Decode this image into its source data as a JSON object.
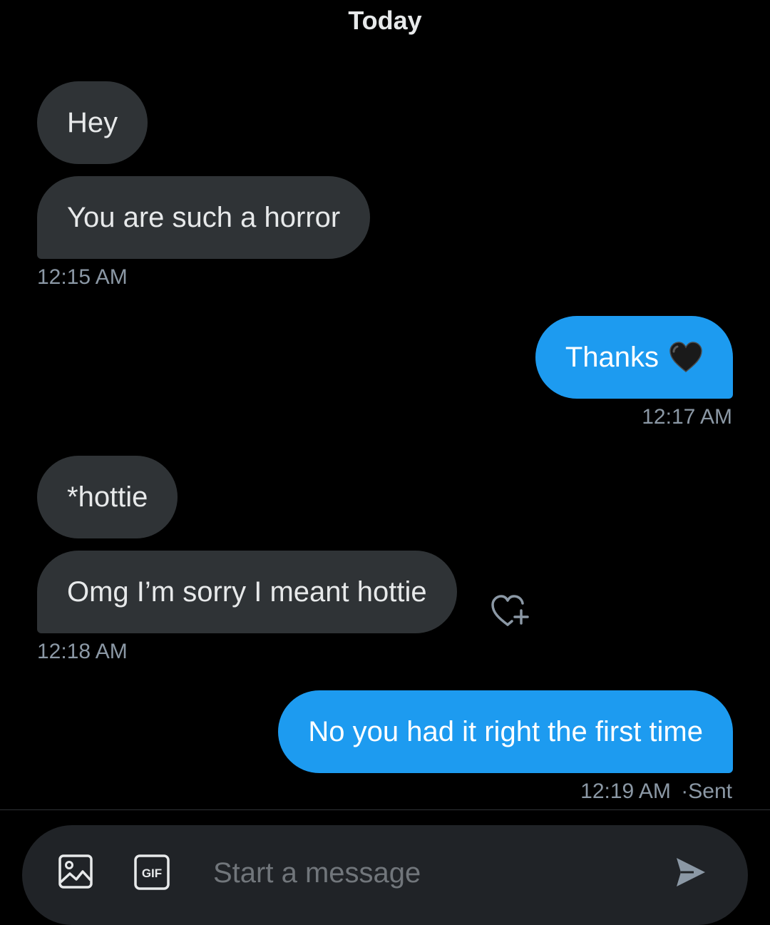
{
  "conversation": {
    "day_label": "Today",
    "messages": [
      {
        "text": "Hey"
      },
      {
        "text": "You are such a horror"
      },
      {
        "time": "12:15 AM"
      },
      {
        "text": "Thanks",
        "emoji": "black-heart-icon"
      },
      {
        "time": "12:17 AM"
      },
      {
        "text": "*hottie"
      },
      {
        "text": "Omg I’m sorry I meant hottie"
      },
      {
        "time": "12:18 AM"
      },
      {
        "text": "No you had it right the first time"
      },
      {
        "time": "12:19 AM",
        "status": "·Sent"
      }
    ]
  },
  "composer": {
    "placeholder": "Start a message",
    "media_icon": "image-icon",
    "gif_icon": "gif-icon",
    "gif_label": "GIF",
    "send_icon": "send-icon"
  },
  "colors": {
    "background": "#000000",
    "incoming_bubble": "#2f3336",
    "outgoing_bubble": "#1d9bf0",
    "timestamp": "#8b98a5",
    "composer_bg": "#202327"
  }
}
